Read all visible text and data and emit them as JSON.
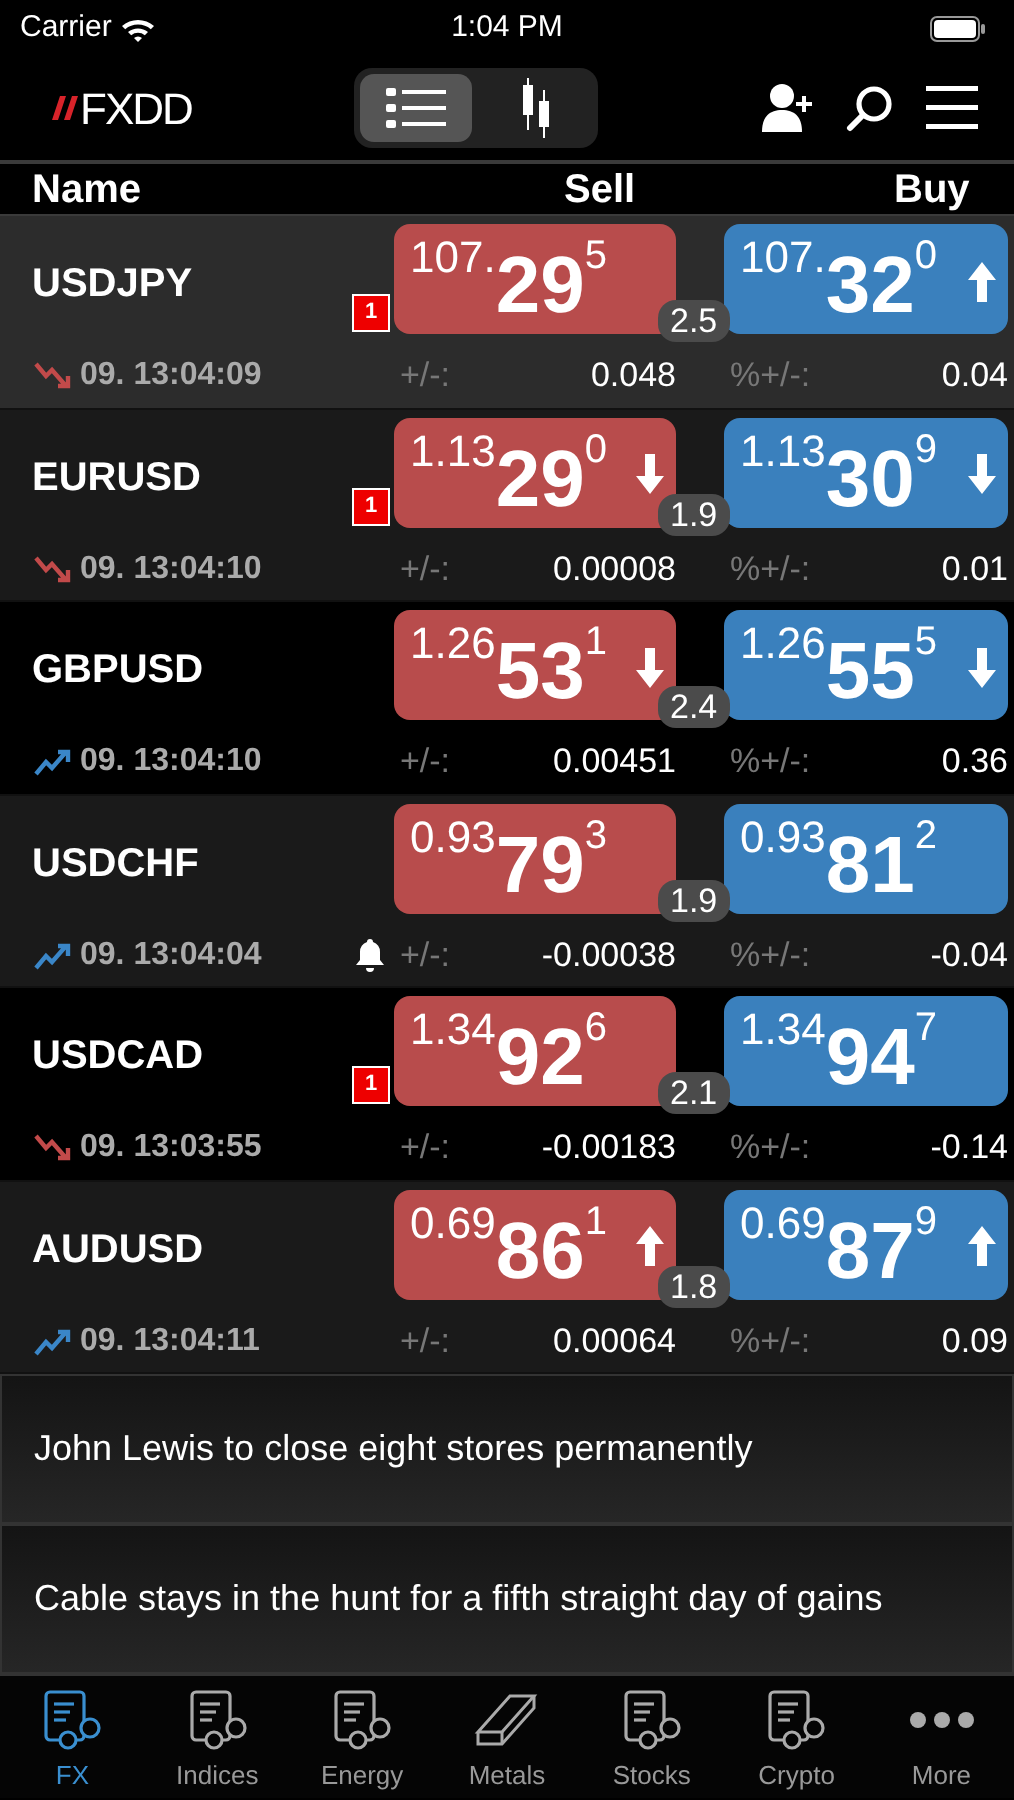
{
  "status_bar": {
    "carrier": "Carrier",
    "time": "1:04 PM"
  },
  "header": {
    "logo": "FXDD",
    "view_toggle": [
      {
        "kind": "list",
        "selected": true
      },
      {
        "kind": "chart",
        "selected": false
      }
    ]
  },
  "columns": [
    "Name",
    "Sell",
    "Buy"
  ],
  "rows": [
    {
      "name": "USDJPY",
      "selected": true,
      "trend_up": false,
      "time": "09. 13:04:09",
      "badge": "1",
      "alert": false,
      "sell": {
        "prefix": "107.",
        "big": "29",
        "pip": "5",
        "tick_up": false,
        "tick_down": false
      },
      "buy": {
        "prefix": "107.",
        "big": "32",
        "pip": "0",
        "tick_up": true,
        "tick_down": false
      },
      "spread": "2.5",
      "change_label": "+/-:",
      "change": "0.048",
      "pct_label": "%+/-:",
      "pct_change": "0.04"
    },
    {
      "name": "EURUSD",
      "selected": false,
      "trend_up": false,
      "time": "09. 13:04:10",
      "badge": "1",
      "alert": false,
      "sell": {
        "prefix": "1.13",
        "big": "29",
        "pip": "0",
        "tick_up": false,
        "tick_down": true
      },
      "buy": {
        "prefix": "1.13",
        "big": "30",
        "pip": "9",
        "tick_up": false,
        "tick_down": true
      },
      "spread": "1.9",
      "change_label": "+/-:",
      "change": "0.00008",
      "pct_label": "%+/-:",
      "pct_change": "0.01"
    },
    {
      "name": "GBPUSD",
      "selected": false,
      "trend_up": true,
      "time": "09. 13:04:10",
      "alert": false,
      "sell": {
        "prefix": "1.26",
        "big": "53",
        "pip": "1",
        "tick_up": false,
        "tick_down": true
      },
      "buy": {
        "prefix": "1.26",
        "big": "55",
        "pip": "5",
        "tick_up": false,
        "tick_down": true
      },
      "spread": "2.4",
      "change_label": "+/-:",
      "change": "0.00451",
      "pct_label": "%+/-:",
      "pct_change": "0.36"
    },
    {
      "name": "USDCHF",
      "selected": false,
      "trend_up": true,
      "time": "09. 13:04:04",
      "alert": true,
      "sell": {
        "prefix": "0.93",
        "big": "79",
        "pip": "3",
        "tick_up": false,
        "tick_down": false
      },
      "buy": {
        "prefix": "0.93",
        "big": "81",
        "pip": "2",
        "tick_up": false,
        "tick_down": false
      },
      "spread": "1.9",
      "change_label": "+/-:",
      "change": "-0.00038",
      "pct_label": "%+/-:",
      "pct_change": "-0.04"
    },
    {
      "name": "USDCAD",
      "selected": false,
      "trend_up": false,
      "time": "09. 13:03:55",
      "badge": "1",
      "alert": false,
      "sell": {
        "prefix": "1.34",
        "big": "92",
        "pip": "6",
        "tick_up": false,
        "tick_down": false
      },
      "buy": {
        "prefix": "1.34",
        "big": "94",
        "pip": "7",
        "tick_up": false,
        "tick_down": false
      },
      "spread": "2.1",
      "change_label": "+/-:",
      "change": "-0.00183",
      "pct_label": "%+/-:",
      "pct_change": "-0.14"
    },
    {
      "name": "AUDUSD",
      "selected": false,
      "trend_up": true,
      "time": "09. 13:04:11",
      "alert": false,
      "sell": {
        "prefix": "0.69",
        "big": "86",
        "pip": "1",
        "tick_up": true,
        "tick_down": false
      },
      "buy": {
        "prefix": "0.69",
        "big": "87",
        "pip": "9",
        "tick_up": true,
        "tick_down": false
      },
      "spread": "1.8",
      "change_label": "+/-:",
      "change": "0.00064",
      "pct_label": "%+/-:",
      "pct_change": "0.09"
    }
  ],
  "news": [
    "John Lewis to close eight stores permanently",
    "Cable stays in the hunt for a fifth straight day of gains"
  ],
  "tab_bar": [
    {
      "label": "FX",
      "kind": "list",
      "selected": true
    },
    {
      "label": "Indices",
      "kind": "list",
      "selected": false
    },
    {
      "label": "Energy",
      "kind": "list",
      "selected": false
    },
    {
      "label": "Metals",
      "kind": "bar",
      "selected": false
    },
    {
      "label": "Stocks",
      "kind": "list",
      "selected": false
    },
    {
      "label": "Crypto",
      "kind": "list",
      "selected": false
    },
    {
      "label": "More",
      "kind": "dots",
      "selected": false
    }
  ]
}
